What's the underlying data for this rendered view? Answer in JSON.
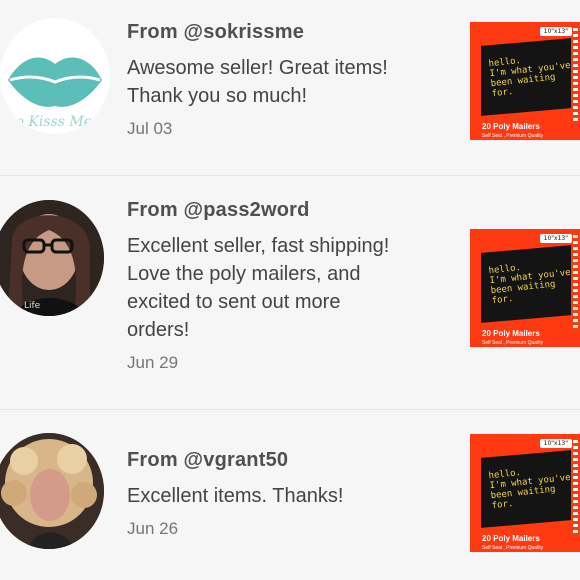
{
  "colors": {
    "background": "#f6f6f6",
    "thumbnail_accent": "#ff3a12",
    "slogan": "#f2d44b"
  },
  "reviews": [
    {
      "from": "From @sokrissme",
      "body": "Awesome seller! Great items!\nThank you so much!",
      "date": "Jul 03",
      "avatar_text": "So Kisss Me",
      "product": {
        "size": "10\"x13\"",
        "slogan": "hello.\nI'm what you've\nbeen waiting for.",
        "title": "20 Poly Mailers",
        "subtitle": "Self Seal , Premium Quality"
      }
    },
    {
      "from": "From @pass2word",
      "body": "Excellent seller, fast shipping!\nLove the poly mailers, and\nexcited to sent out more\norders!",
      "date": "Jun 29",
      "avatar_text": "Life",
      "product": {
        "size": "10\"x13\"",
        "slogan": "hello.\nI'm what you've\nbeen waiting for.",
        "title": "20 Poly Mailers",
        "subtitle": "Self Seal , Premium Quality"
      }
    },
    {
      "from": "From @vgrant50",
      "body": "Excellent items. Thanks!",
      "date": "Jun 26",
      "avatar_text": "",
      "product": {
        "size": "10\"x13\"",
        "slogan": "hello.\nI'm what you've\nbeen waiting for.",
        "title": "20 Poly Mailers",
        "subtitle": "Self Seal , Premium Quality"
      }
    }
  ]
}
